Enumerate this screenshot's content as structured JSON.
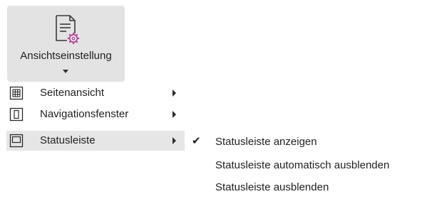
{
  "ribbon": {
    "button_label": "Ansichtseinstellung",
    "icon": "document-settings-icon"
  },
  "menu": {
    "items": [
      {
        "label": "Seitenansicht",
        "icon": "grid-view-icon",
        "has_submenu": true,
        "active": false
      },
      {
        "label": "Navigationsfenster",
        "icon": "navigation-pane-icon",
        "has_submenu": true,
        "active": false
      },
      {
        "label": "Statusleiste",
        "icon": "status-bar-icon",
        "has_submenu": true,
        "active": true
      }
    ]
  },
  "submenu": {
    "items": [
      {
        "label": "Statusleiste anzeigen",
        "checked": true,
        "check_mark": "✔"
      },
      {
        "label": "Statusleiste automatisch ausblenden",
        "checked": false
      },
      {
        "label": "Statusleiste ausblenden",
        "checked": false
      }
    ]
  },
  "colors": {
    "ribbon_pressed_bg": "#e3e3e3",
    "menu_active_bg": "#e6e6e6",
    "icon_accent": "#b6479a",
    "text": "#1f1f1f"
  }
}
